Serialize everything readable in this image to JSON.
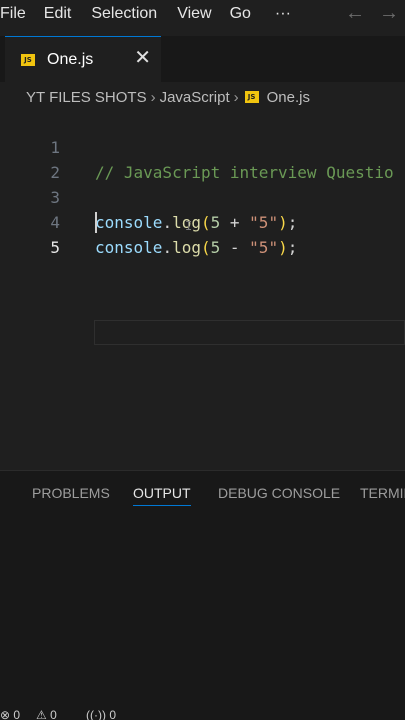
{
  "menubar": {
    "items": [
      "File",
      "Edit",
      "Selection",
      "View",
      "Go"
    ],
    "more": "···",
    "back": "←",
    "forward": "→"
  },
  "tab": {
    "badge": "JS",
    "title": "One.js",
    "close": "✕"
  },
  "breadcrumb": {
    "root": "YT FILES SHOTS",
    "sep": "›",
    "folder": "JavaScript",
    "file": "One.js"
  },
  "editor": {
    "line_numbers": [
      "1",
      "2",
      "3",
      "4",
      "5"
    ],
    "line1_comment": "// JavaScript interview Questio",
    "line3": {
      "obj": "console",
      "dot": ".",
      "fn": "log",
      "open": "(",
      "num": "5",
      "op": " + ",
      "str": "\"5\"",
      "close": ")",
      "semi": ";"
    },
    "line4": {
      "obj": "console",
      "dot": ".",
      "fn": "log",
      "open": "(",
      "num": "5",
      "op": " - ",
      "str": "\"5\"",
      "close": ")",
      "semi": ";"
    },
    "ibeam": "I"
  },
  "panel": {
    "tabs": [
      "PROBLEMS",
      "OUTPUT",
      "DEBUG CONSOLE",
      "TERMIN"
    ],
    "active": "OUTPUT"
  },
  "statusbar": {
    "errors": "⊗ 0",
    "warnings": "⚠ 0",
    "ports": "((·)) 0"
  },
  "colors": {
    "accent": "#0078d4",
    "js_badge": "#f1c40f",
    "background": "#1f1f1f"
  }
}
